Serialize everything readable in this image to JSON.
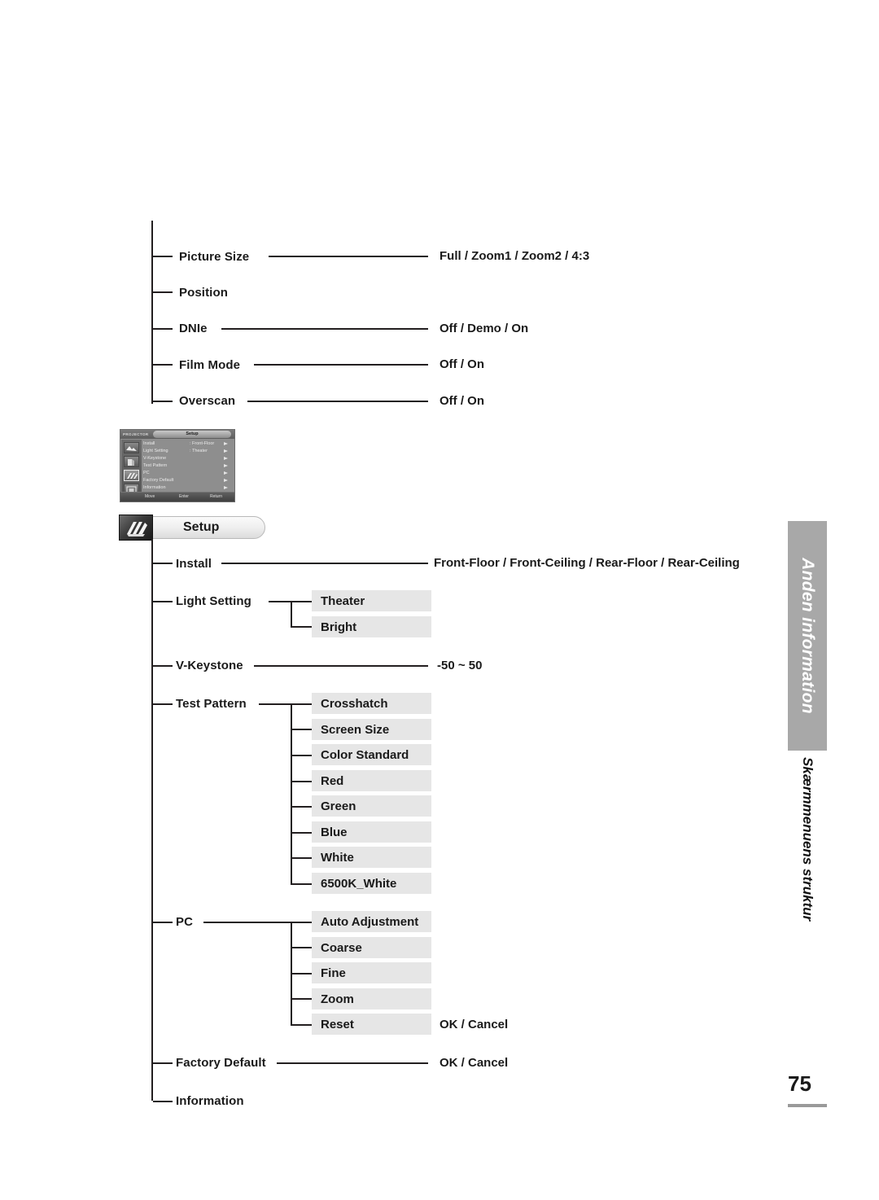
{
  "page": {
    "number": "75",
    "side_tab_label": "Anden information",
    "side_sub_label": "Skærmmenuens struktur"
  },
  "top_tree": {
    "items": [
      {
        "label": "Picture Size",
        "value": "Full / Zoom1 / Zoom2 / 4:3",
        "has_connector": true
      },
      {
        "label": "Position",
        "value": "",
        "has_connector": false
      },
      {
        "label": "DNIe",
        "value": "Off / Demo / On",
        "has_connector": true
      },
      {
        "label": "Film Mode",
        "value": "Off / On",
        "has_connector": true
      },
      {
        "label": "Overscan",
        "value": "Off / On",
        "has_connector": true
      }
    ]
  },
  "osd": {
    "brand": "PROJECTOR",
    "title": "Setup",
    "rows": [
      {
        "key": "Install",
        "value": ": Front-Floor"
      },
      {
        "key": "Light Setting",
        "value": ": Theater"
      },
      {
        "key": "V-Keystone",
        "value": ""
      },
      {
        "key": "Test Pattern",
        "value": ""
      },
      {
        "key": "PC",
        "value": ""
      },
      {
        "key": "Factory Default",
        "value": ""
      },
      {
        "key": "Information",
        "value": ""
      }
    ],
    "hints": {
      "move": "Move",
      "enter": "Enter",
      "return": "Return"
    },
    "icons": [
      "picture-icon",
      "sound-icon",
      "setup-icon",
      "input-icon"
    ],
    "selected_icon_index": 2
  },
  "setup_header": {
    "label": "Setup",
    "icon": "setup-hand-icon"
  },
  "setup_tree": {
    "install": {
      "label": "Install",
      "value": "Front-Floor / Front-Ceiling / Rear-Floor / Rear-Ceiling"
    },
    "light_setting": {
      "label": "Light Setting",
      "options": [
        "Theater",
        "Bright"
      ]
    },
    "v_keystone": {
      "label": "V-Keystone",
      "value": "-50 ~ 50"
    },
    "test_pattern": {
      "label": "Test Pattern",
      "options": [
        "Crosshatch",
        "Screen Size",
        "Color Standard",
        "Red",
        "Green",
        "Blue",
        "White",
        "6500K_White"
      ]
    },
    "pc": {
      "label": "PC",
      "options": [
        "Auto Adjustment",
        "Coarse",
        "Fine",
        "Zoom",
        "Reset"
      ],
      "reset_value": "OK / Cancel"
    },
    "factory_default": {
      "label": "Factory Default",
      "value": "OK / Cancel"
    },
    "information": {
      "label": "Information",
      "value": ""
    }
  }
}
